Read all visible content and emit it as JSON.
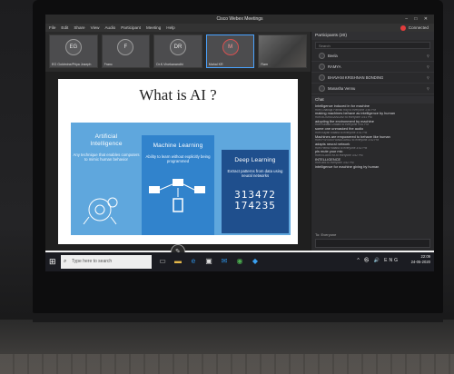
{
  "app": {
    "title": "Cisco Webex Meetings",
    "window_controls": "–  □  ✕",
    "connected": "Connected"
  },
  "menu": [
    "File",
    "Edit",
    "Share",
    "View",
    "Audio",
    "Participant",
    "Meeting",
    "Help"
  ],
  "thumbnails": [
    {
      "initials": "EG",
      "name": "EG Goldmine/Priya Joseph",
      "active": false,
      "video": false,
      "avatar_red": false
    },
    {
      "initials": "F",
      "name": "Franc",
      "active": false,
      "video": false,
      "avatar_red": false
    },
    {
      "initials": "DR",
      "name": "Dr.K.Vivekanandhi",
      "active": false,
      "video": false,
      "avatar_red": false
    },
    {
      "initials": "M",
      "name": "Mahal KR",
      "active": true,
      "video": false,
      "avatar_red": true
    },
    {
      "initials": "",
      "name": "Ram",
      "active": false,
      "video": true,
      "avatar_red": false
    }
  ],
  "slide": {
    "title": "What is AI ?",
    "panels": [
      {
        "title_line1": "Artificial",
        "title_line2": "Intelligence",
        "description": "Any technique that enables computers to mimic human behavior"
      },
      {
        "title_line1": "Machine Learning",
        "title_line2": "",
        "description": "Ability to learn without explicitly being programmed"
      },
      {
        "title_line1": "Deep Learning",
        "title_line2": "",
        "description": "Extract patterns from data using neural networks"
      }
    ],
    "digits_line1": "313472",
    "digits_line2": "174235"
  },
  "participants": {
    "header": "Participants (20)",
    "search_placeholder": "Search",
    "items": [
      "Beela",
      "RAMYA",
      "BHAVANI KRISHNAN BONDING",
      "Manasha Vennu"
    ]
  },
  "chat": {
    "header": "Chat",
    "lines": [
      {
        "text": "Intelligence induced in for machine",
        "meta": "from Gnanaja Pathak Rdy to everyone  3:50 PM"
      },
      {
        "text": "making machines behave as intelligence by human",
        "meta": "from BOSHASANGAVI to everyone  3:51 PM"
      },
      {
        "text": "adopting the environment by machine",
        "meta": "from Kalasa Chalani to everyone  3:51 PM"
      },
      {
        "text": "some one unmasked the audio",
        "meta": "from Kayan Maana to everyone  3:51 PM"
      },
      {
        "text": "Machines are empowered to behave like human",
        "meta": "from PSRIVATHANAGARAJ to everyone  3:52 PM"
      },
      {
        "text": "adapts neural network",
        "meta": "from Hema Ratana to everyone  3:52 PM"
      },
      {
        "text": "pls mute your mic",
        "meta": "from ELAKKIYA to everyone  3:52 PM"
      },
      {
        "text": "INTELLIGENCE",
        "meta": "from abc to everyone  3:52 PM"
      },
      {
        "text": "intelligence for machine giving by human",
        "meta": ""
      }
    ],
    "to_label": "To:",
    "to_value": "Everyone"
  },
  "taskbar": {
    "search_placeholder": "Type here to search",
    "time": "22:09",
    "date": "24-05-2020",
    "tray": "^ ㉿ 🔊 ENG"
  }
}
